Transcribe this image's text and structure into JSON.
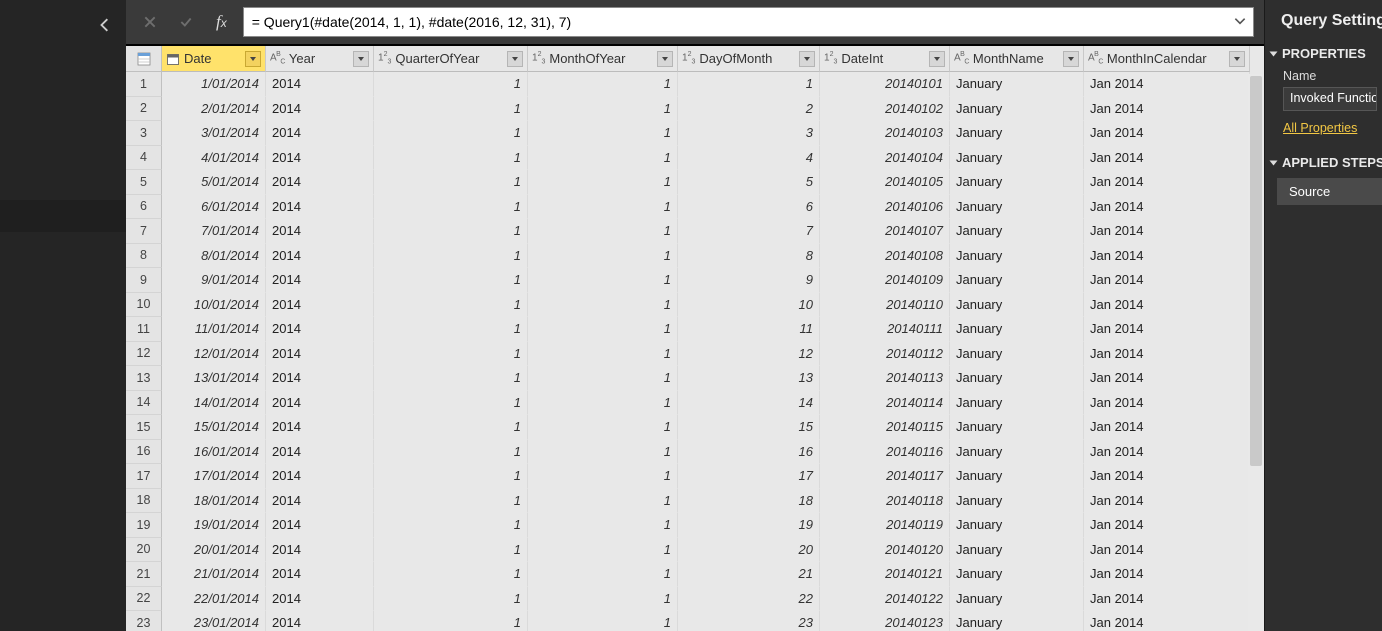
{
  "formula": "= Query1(#date(2014, 1, 1), #date(2016, 12, 31), 7)",
  "columns": [
    {
      "name": "Date",
      "type": "cal",
      "selected": true,
      "class": "num ital"
    },
    {
      "name": "Year",
      "type": "abc",
      "class": ""
    },
    {
      "name": "QuarterOfYear",
      "type": "num",
      "class": "num ital"
    },
    {
      "name": "MonthOfYear",
      "type": "num",
      "class": "num ital"
    },
    {
      "name": "DayOfMonth",
      "type": "num",
      "class": "num ital"
    },
    {
      "name": "DateInt",
      "type": "num",
      "class": "num ital"
    },
    {
      "name": "MonthName",
      "type": "abc",
      "class": ""
    },
    {
      "name": "MonthInCalendar",
      "type": "abc",
      "class": ""
    }
  ],
  "rows": [
    [
      "1/01/2014",
      "2014",
      "1",
      "1",
      "1",
      "20140101",
      "January",
      "Jan 2014"
    ],
    [
      "2/01/2014",
      "2014",
      "1",
      "1",
      "2",
      "20140102",
      "January",
      "Jan 2014"
    ],
    [
      "3/01/2014",
      "2014",
      "1",
      "1",
      "3",
      "20140103",
      "January",
      "Jan 2014"
    ],
    [
      "4/01/2014",
      "2014",
      "1",
      "1",
      "4",
      "20140104",
      "January",
      "Jan 2014"
    ],
    [
      "5/01/2014",
      "2014",
      "1",
      "1",
      "5",
      "20140105",
      "January",
      "Jan 2014"
    ],
    [
      "6/01/2014",
      "2014",
      "1",
      "1",
      "6",
      "20140106",
      "January",
      "Jan 2014"
    ],
    [
      "7/01/2014",
      "2014",
      "1",
      "1",
      "7",
      "20140107",
      "January",
      "Jan 2014"
    ],
    [
      "8/01/2014",
      "2014",
      "1",
      "1",
      "8",
      "20140108",
      "January",
      "Jan 2014"
    ],
    [
      "9/01/2014",
      "2014",
      "1",
      "1",
      "9",
      "20140109",
      "January",
      "Jan 2014"
    ],
    [
      "10/01/2014",
      "2014",
      "1",
      "1",
      "10",
      "20140110",
      "January",
      "Jan 2014"
    ],
    [
      "11/01/2014",
      "2014",
      "1",
      "1",
      "11",
      "20140111",
      "January",
      "Jan 2014"
    ],
    [
      "12/01/2014",
      "2014",
      "1",
      "1",
      "12",
      "20140112",
      "January",
      "Jan 2014"
    ],
    [
      "13/01/2014",
      "2014",
      "1",
      "1",
      "13",
      "20140113",
      "January",
      "Jan 2014"
    ],
    [
      "14/01/2014",
      "2014",
      "1",
      "1",
      "14",
      "20140114",
      "January",
      "Jan 2014"
    ],
    [
      "15/01/2014",
      "2014",
      "1",
      "1",
      "15",
      "20140115",
      "January",
      "Jan 2014"
    ],
    [
      "16/01/2014",
      "2014",
      "1",
      "1",
      "16",
      "20140116",
      "January",
      "Jan 2014"
    ],
    [
      "17/01/2014",
      "2014",
      "1",
      "1",
      "17",
      "20140117",
      "January",
      "Jan 2014"
    ],
    [
      "18/01/2014",
      "2014",
      "1",
      "1",
      "18",
      "20140118",
      "January",
      "Jan 2014"
    ],
    [
      "19/01/2014",
      "2014",
      "1",
      "1",
      "19",
      "20140119",
      "January",
      "Jan 2014"
    ],
    [
      "20/01/2014",
      "2014",
      "1",
      "1",
      "20",
      "20140120",
      "January",
      "Jan 2014"
    ],
    [
      "21/01/2014",
      "2014",
      "1",
      "1",
      "21",
      "20140121",
      "January",
      "Jan 2014"
    ],
    [
      "22/01/2014",
      "2014",
      "1",
      "1",
      "22",
      "20140122",
      "January",
      "Jan 2014"
    ],
    [
      "23/01/2014",
      "2014",
      "1",
      "1",
      "23",
      "20140123",
      "January",
      "Jan 2014"
    ]
  ],
  "settings": {
    "title": "Query Settings",
    "properties_label": "PROPERTIES",
    "name_label": "Name",
    "name_value": "Invoked Function",
    "all_props": "All Properties",
    "steps_label": "APPLIED STEPS",
    "step_source": "Source"
  }
}
